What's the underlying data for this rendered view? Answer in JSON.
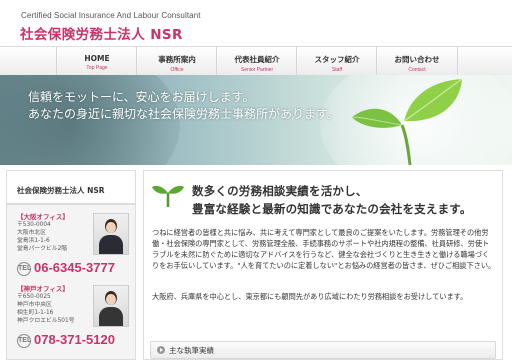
{
  "header": {
    "subtitle": "Certified Social Insurance And Labour Consultant",
    "title": "社会保険労務士法人 NSR"
  },
  "nav": [
    {
      "label": "HOME",
      "sub": "Top Page"
    },
    {
      "label": "事務所案内",
      "sub": "Office"
    },
    {
      "label": "代表社員紹介",
      "sub": "Senior Partner"
    },
    {
      "label": "スタッフ紹介",
      "sub": "Staff"
    },
    {
      "label": "お問い合わせ",
      "sub": "Contact"
    }
  ],
  "hero": {
    "line1": "信頼をモットーに、安心をお届けします。",
    "line2": "あなたの身近に親切な社会保険労務士事務所があります。"
  },
  "sidebar": {
    "title": "社会保険労務士法人 NSR",
    "osaka": {
      "label": "【大阪オフィス】",
      "address": "〒530-0004\n大阪市北区\n堂島浜1-1-6\n堂島パークビル2階",
      "tel": "06-6345-3777"
    },
    "kobe": {
      "label": "【神戸オフィス】",
      "address": "〒650-0025\n神戸市中央区\n相生町1-1-16\n神戸クロエビル501号",
      "tel": "078-371-5120"
    },
    "tel_icon": "TEL"
  },
  "main": {
    "headline1": "数多くの労務相談実績を活かし、",
    "headline2": "豊富な経験と最新の知識であなたの会社を支えます。",
    "paragraph1": "つねに経営者の皆様と共に悩み、共に考えて専門家として最良のご提案をいたします。労務管理その他労働・社会保険の専門家として、労務管理全般、手続事務のサポートや社内規程の整備、社員研修、労使トラブルを未然に防ぐために適切なアドバイスを行うなど、健全な会社づくりと生き生きと働ける職場づくりをお手伝いしています。\"人を育てたいのに定着しない\"とお悩みの経営者の皆さま、ぜひご相談下さい。",
    "paragraph2": "大阪府、兵庫県を中心とし、東京都にも顧問先があり広域にわたり労務相談をお受けしています。",
    "achievements": "主な執筆実績"
  },
  "colors": {
    "accent": "#c8336a",
    "text": "#333333"
  }
}
